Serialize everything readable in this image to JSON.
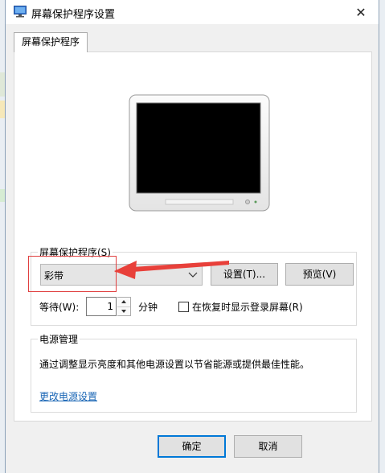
{
  "window": {
    "title": "屏幕保护程序设置",
    "close_glyph": "✕"
  },
  "tabs": [
    {
      "label": "屏幕保护程序"
    }
  ],
  "screensaver": {
    "group_label": "屏幕保护程序(S)",
    "selected": "彩带",
    "settings_label": "设置(T)...",
    "preview_label": "预览(V)",
    "wait_label": "等待(W):",
    "wait_value": "1",
    "minute_label": "分钟",
    "resume_label": "在恢复时显示登录屏幕(R)",
    "resume_checked": false
  },
  "power": {
    "group_label": "电源管理",
    "description": "通过调整显示亮度和其他电源设置以节省能源或提供最佳性能。",
    "link_label": "更改电源设置"
  },
  "footer": {
    "ok_label": "确定",
    "cancel_label": "取消"
  },
  "colors": {
    "accent": "#0078d7",
    "link": "#1a66b5",
    "annotation": "#e04040"
  }
}
